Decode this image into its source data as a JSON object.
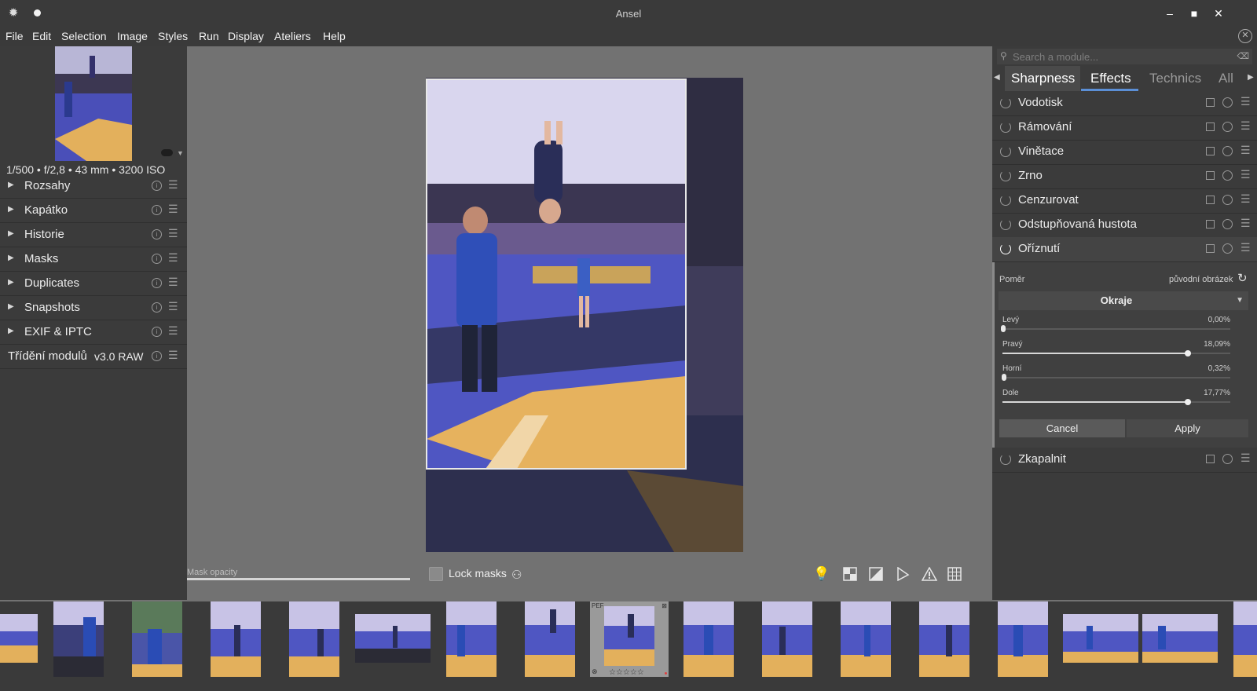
{
  "window": {
    "title": "Ansel"
  },
  "menu": [
    "File",
    "Edit",
    "Selection",
    "Image",
    "Styles",
    "Run",
    "Display",
    "Ateliers",
    "Help"
  ],
  "left_panel": {
    "exif_line": "1/500 • f/2,8 • 43 mm • 3200 ISO",
    "sections": [
      "Rozsahy",
      "Kapátko",
      "Historie",
      "Masks",
      "Duplicates",
      "Snapshots",
      "EXIF & IPTC"
    ],
    "module_sort": {
      "label": "Třídění modulů",
      "value": "v3.0 RAW"
    }
  },
  "right_panel": {
    "search_placeholder": "Search a module...",
    "tabs": [
      "Sharpness",
      "Effects",
      "Technics",
      "All"
    ],
    "active_tab": "Effects",
    "modules": [
      "Vodotisk",
      "Rámování",
      "Vinětace",
      "Zrno",
      "Cenzurovat",
      "Odstupňovaná hustota",
      "Oříznutí"
    ],
    "crop": {
      "ratio_label": "Poměr",
      "ratio_value": "původní obrázek",
      "margins_title": "Okraje",
      "sliders": [
        {
          "label": "Levý",
          "value_text": "0,00%",
          "value": 0.0
        },
        {
          "label": "Pravý",
          "value_text": "18,09%",
          "value": 0.8
        },
        {
          "label": "Horní",
          "value_text": "0,32%",
          "value": 0.01
        },
        {
          "label": "Dole",
          "value_text": "17,77%",
          "value": 0.8
        }
      ],
      "cancel_label": "Cancel",
      "apply_label": "Apply"
    },
    "after_modules": [
      "Zkapalnit"
    ]
  },
  "bottom_bar": {
    "mask_opacity_label": "Mask opacity",
    "lock_masks_label": "Lock masks"
  },
  "filmstrip": {
    "selected_badge": "PEF",
    "rating_stars": "☆☆☆☆☆"
  },
  "colors": {
    "accent": "#5b8fd6",
    "panel": "#3b3b3b",
    "canvas": "#727272"
  }
}
